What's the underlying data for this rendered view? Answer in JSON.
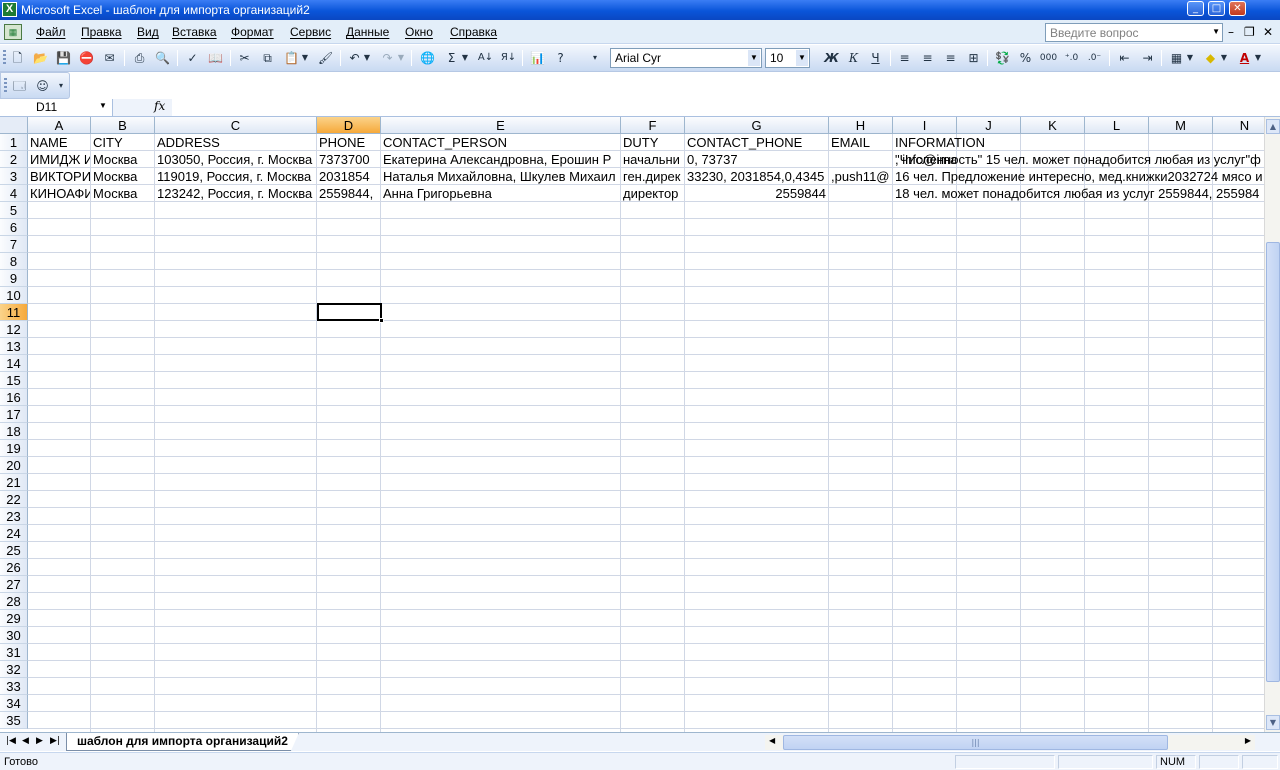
{
  "window": {
    "title": "Microsoft Excel - шаблон для импорта организаций2",
    "app_icon": "excel-icon",
    "controls": [
      "minimize-icon",
      "maximize-icon",
      "close-icon"
    ]
  },
  "menu": {
    "items": [
      "Файл",
      "Правка",
      "Вид",
      "Вставка",
      "Формат",
      "Сервис",
      "Данные",
      "Окно",
      "Справка"
    ],
    "help_placeholder": "Введите вопрос"
  },
  "toolbar": {
    "font_name": "Arial Cyr",
    "font_size": "10",
    "bold_label": "Ж",
    "italic_label": "К",
    "underline_label": "Ч",
    "percent_label": "%",
    "thousands_label": "000",
    "sigma_label": "Σ",
    "font_color_label": "А"
  },
  "formula_bar": {
    "name_box": "D11",
    "fx_label": "fx",
    "formula": ""
  },
  "grid": {
    "columns": [
      "A",
      "B",
      "C",
      "D",
      "E",
      "F",
      "G",
      "H",
      "I",
      "J",
      "K",
      "L",
      "M",
      "N"
    ],
    "active_column": "D",
    "active_row": 11,
    "rows": [
      1,
      2,
      3,
      4,
      5,
      6,
      7,
      8,
      9,
      10,
      11,
      12,
      13,
      14,
      15,
      16,
      17,
      18,
      19,
      20,
      21,
      22,
      23,
      24,
      25,
      26,
      27,
      28,
      29,
      30,
      31,
      32,
      33,
      34,
      35
    ],
    "cells": {
      "r1": [
        "NAME",
        "CITY",
        "ADDRESS",
        "PHONE",
        "CONTACT_PERSON",
        "DUTY",
        "CONTACT_PHONE",
        "EMAIL",
        "INFORMATION"
      ],
      "r2": [
        "ИМИДЖ И",
        "Москва",
        " 103050, Россия, г. Москва",
        " 7373700",
        " Екатерина Александровна,  Ерошин Р",
        " начальни",
        "0, 73737",
        "",
        ", info@ima",
        "\"Численность\" 15 чел. может понадобится любая из услуг\"ф"
      ],
      "r3": [
        "ВИКТОРИ",
        "Москва",
        " 119019, Россия, г. Москва",
        " 2031854",
        " Наталья Михайловна, Шкулев Михаил",
        " ген.дирек",
        "33230, 2031854,0,4345",
        "",
        " ,push11@",
        " 16 чел. Предложение интересно, мед.книжки2032724 мясо и"
      ],
      "r4": [
        "КИНОАФИ",
        "Москва",
        " 123242, Россия, г. Москва",
        "2559844,",
        " Анна Григорьевна",
        "директор",
        "2559844",
        "",
        "",
        " 18 чел. может понадобится любая из услуг 2559844, 255984"
      ]
    }
  },
  "sheet_tabs": {
    "active": "шаблон для импорта организаций2"
  },
  "status": {
    "ready": "Готово",
    "num": "NUM"
  }
}
